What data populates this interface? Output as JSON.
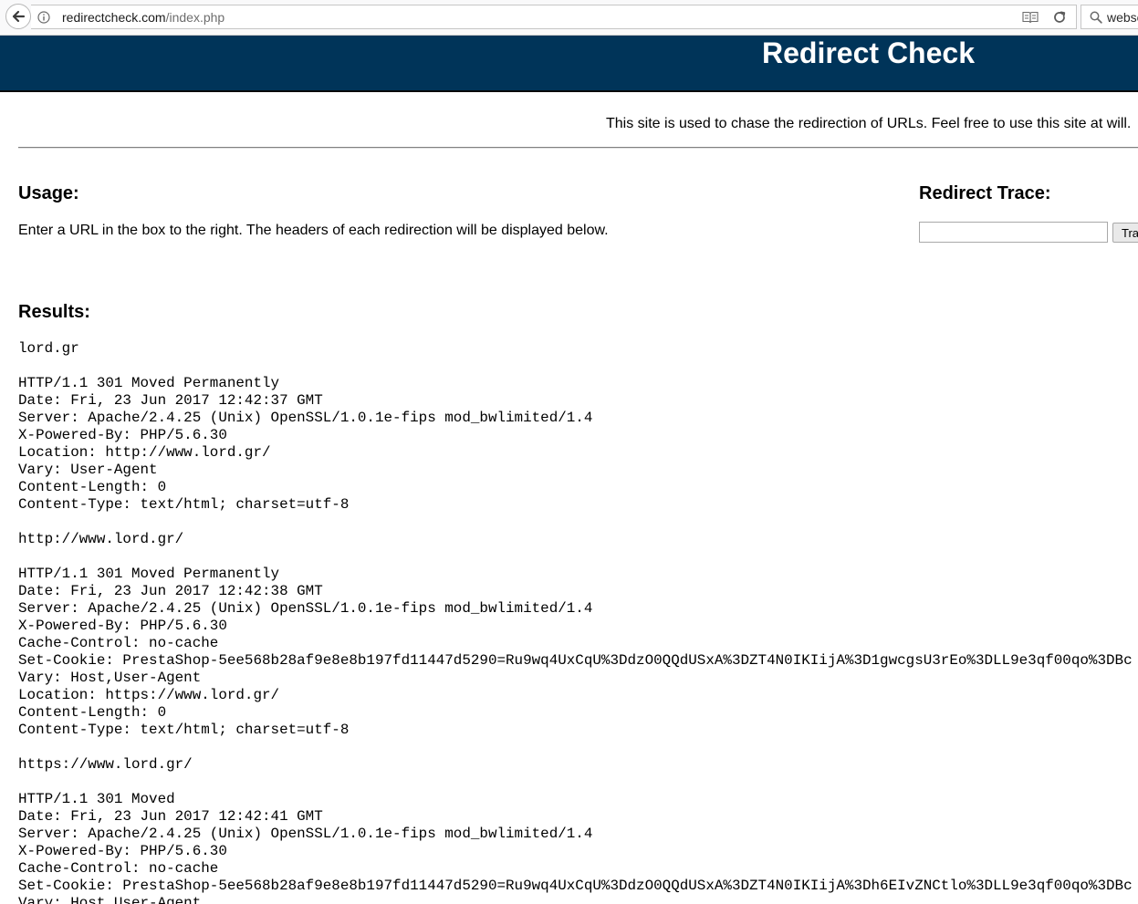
{
  "browser": {
    "url_host": "redirectcheck.com",
    "url_path": "/index.php",
    "search_text": "webse"
  },
  "header": {
    "title": "Redirect Check"
  },
  "tagline": "This site is used to chase the redirection of URLs. Feel free to use this site at will.",
  "usage": {
    "heading": "Usage:",
    "text": "Enter a URL in the box to the right. The headers of each redirection will be displayed below."
  },
  "trace": {
    "heading": "Redirect Trace:",
    "input_value": "",
    "button_label": "Trace"
  },
  "results": {
    "heading": "Results:",
    "lines": [
      "lord.gr",
      "",
      "HTTP/1.1 301 Moved Permanently",
      "Date: Fri, 23 Jun 2017 12:42:37 GMT",
      "Server: Apache/2.4.25 (Unix) OpenSSL/1.0.1e-fips mod_bwlimited/1.4",
      "X-Powered-By: PHP/5.6.30",
      "Location: http://www.lord.gr/",
      "Vary: User-Agent",
      "Content-Length: 0",
      "Content-Type: text/html; charset=utf-8",
      "",
      "http://www.lord.gr/",
      "",
      "HTTP/1.1 301 Moved Permanently",
      "Date: Fri, 23 Jun 2017 12:42:38 GMT",
      "Server: Apache/2.4.25 (Unix) OpenSSL/1.0.1e-fips mod_bwlimited/1.4",
      "X-Powered-By: PHP/5.6.30",
      "Cache-Control: no-cache",
      "Set-Cookie: PrestaShop-5ee568b28af9e8e8b197fd11447d5290=Ru9wq4UxCqU%3DdzO0QQdUSxA%3DZT4N0IKIijA%3D1gwcgsU3rEo%3DLL9e3qf00qo%3DBc",
      "Vary: Host,User-Agent",
      "Location: https://www.lord.gr/",
      "Content-Length: 0",
      "Content-Type: text/html; charset=utf-8",
      "",
      "https://www.lord.gr/",
      "",
      "HTTP/1.1 301 Moved",
      "Date: Fri, 23 Jun 2017 12:42:41 GMT",
      "Server: Apache/2.4.25 (Unix) OpenSSL/1.0.1e-fips mod_bwlimited/1.4",
      "X-Powered-By: PHP/5.6.30",
      "Cache-Control: no-cache",
      "Set-Cookie: PrestaShop-5ee568b28af9e8e8b197fd11447d5290=Ru9wq4UxCqU%3DdzO0QQdUSxA%3DZT4N0IKIijA%3Dh6EIvZNCtlo%3DLL9e3qf00qo%3DBc",
      "Vary: Host,User-Agent"
    ]
  },
  "icons": {
    "back": "back-arrow-icon",
    "info": "info-icon",
    "reader": "reader-view-icon",
    "reload": "reload-icon",
    "search": "search-icon"
  },
  "colors": {
    "header_background": "#003459",
    "header_text": "#ffffff"
  }
}
